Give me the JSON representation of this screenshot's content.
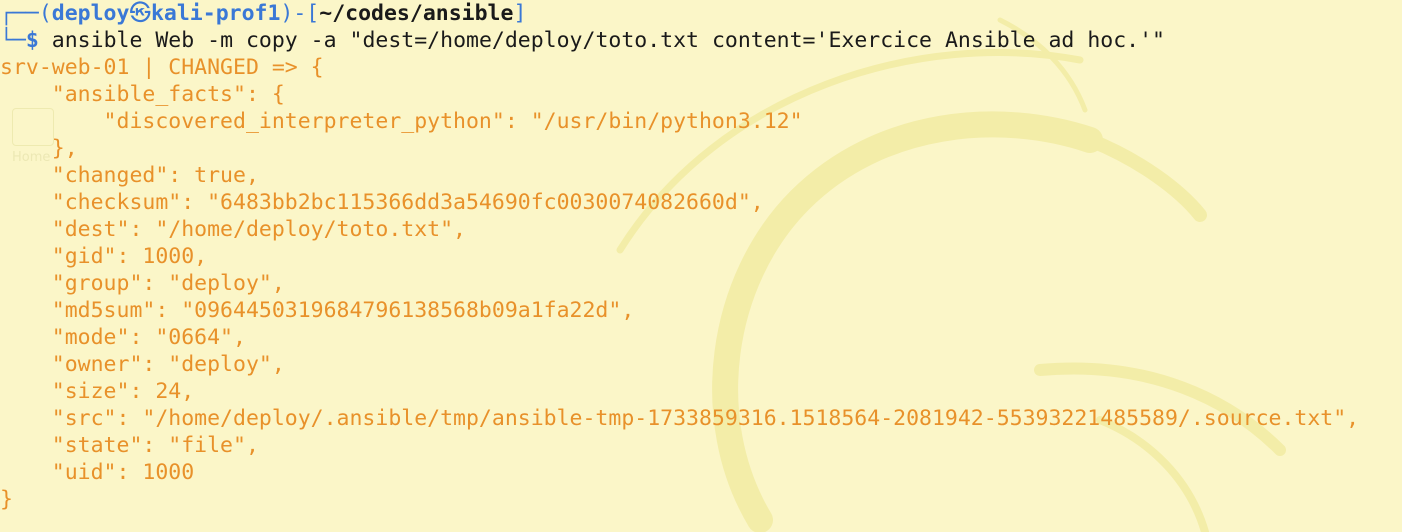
{
  "prompt": {
    "user": "deploy",
    "separator_glyph": "㉿",
    "host": "kali-prof1",
    "path": "~/codes/ansible",
    "symbol": "$",
    "command": "ansible Web -m copy -a \"dest=/home/deploy/toto.txt content='Exercice Ansible ad hoc.'\""
  },
  "desktop": {
    "icon_label": "Home"
  },
  "output": {
    "lines": [
      "srv-web-01 | CHANGED => {",
      "    \"ansible_facts\": {",
      "        \"discovered_interpreter_python\": \"/usr/bin/python3.12\"",
      "    },",
      "    \"changed\": true,",
      "    \"checksum\": \"6483bb2bc115366dd3a54690fc0030074082660d\",",
      "    \"dest\": \"/home/deploy/toto.txt\",",
      "    \"gid\": 1000,",
      "    \"group\": \"deploy\",",
      "    \"md5sum\": \"0964450319684796138568b09a1fa22d\",",
      "    \"mode\": \"0664\",",
      "    \"owner\": \"deploy\",",
      "    \"size\": 24,",
      "    \"src\": \"/home/deploy/.ansible/tmp/ansible-tmp-1733859316.1518564-2081942-55393221485589/.source.txt\",",
      "    \"state\": \"file\",",
      "    \"uid\": 1000",
      "}"
    ]
  },
  "colors": {
    "background": "#fbf6c8",
    "prompt_blue": "#3a78d6",
    "output_orange": "#e8912a",
    "command_text": "#1a1a1a"
  }
}
